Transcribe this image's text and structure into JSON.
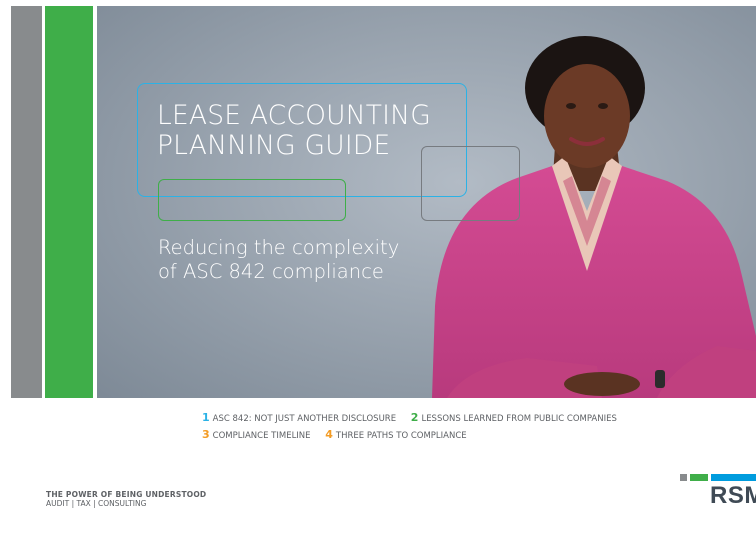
{
  "cover": {
    "title_lines": [
      "LEASE ACCOUNTING",
      "PLANNING GUIDE"
    ],
    "subtitle_lines": [
      "Reducing the complexity",
      "of ASC 842 compliance"
    ]
  },
  "toc": [
    {
      "num": "1",
      "label": "ASC 842: NOT JUST ANOTHER DISCLOSURE",
      "color": "#2bb2e6"
    },
    {
      "num": "2",
      "label": "LESSONS LEARNED FROM PUBLIC COMPANIES",
      "color": "#3fae49"
    },
    {
      "num": "3",
      "label": "COMPLIANCE TIMELINE",
      "color": "#f39c25"
    },
    {
      "num": "4",
      "label": "THREE PATHS TO COMPLIANCE",
      "color": "#f39c25"
    }
  ],
  "footer": {
    "tagline": "THE POWER OF BEING UNDERSTOOD",
    "services": "AUDIT | TAX | CONSULTING",
    "logo_text": "RSM"
  },
  "colors": {
    "blue": "#2bb2e6",
    "green": "#3fae49",
    "gray": "#888b8d",
    "orange": "#f39c25",
    "logo_gray": "#888b8d",
    "logo_green": "#3fae49",
    "logo_blue": "#009cde"
  }
}
